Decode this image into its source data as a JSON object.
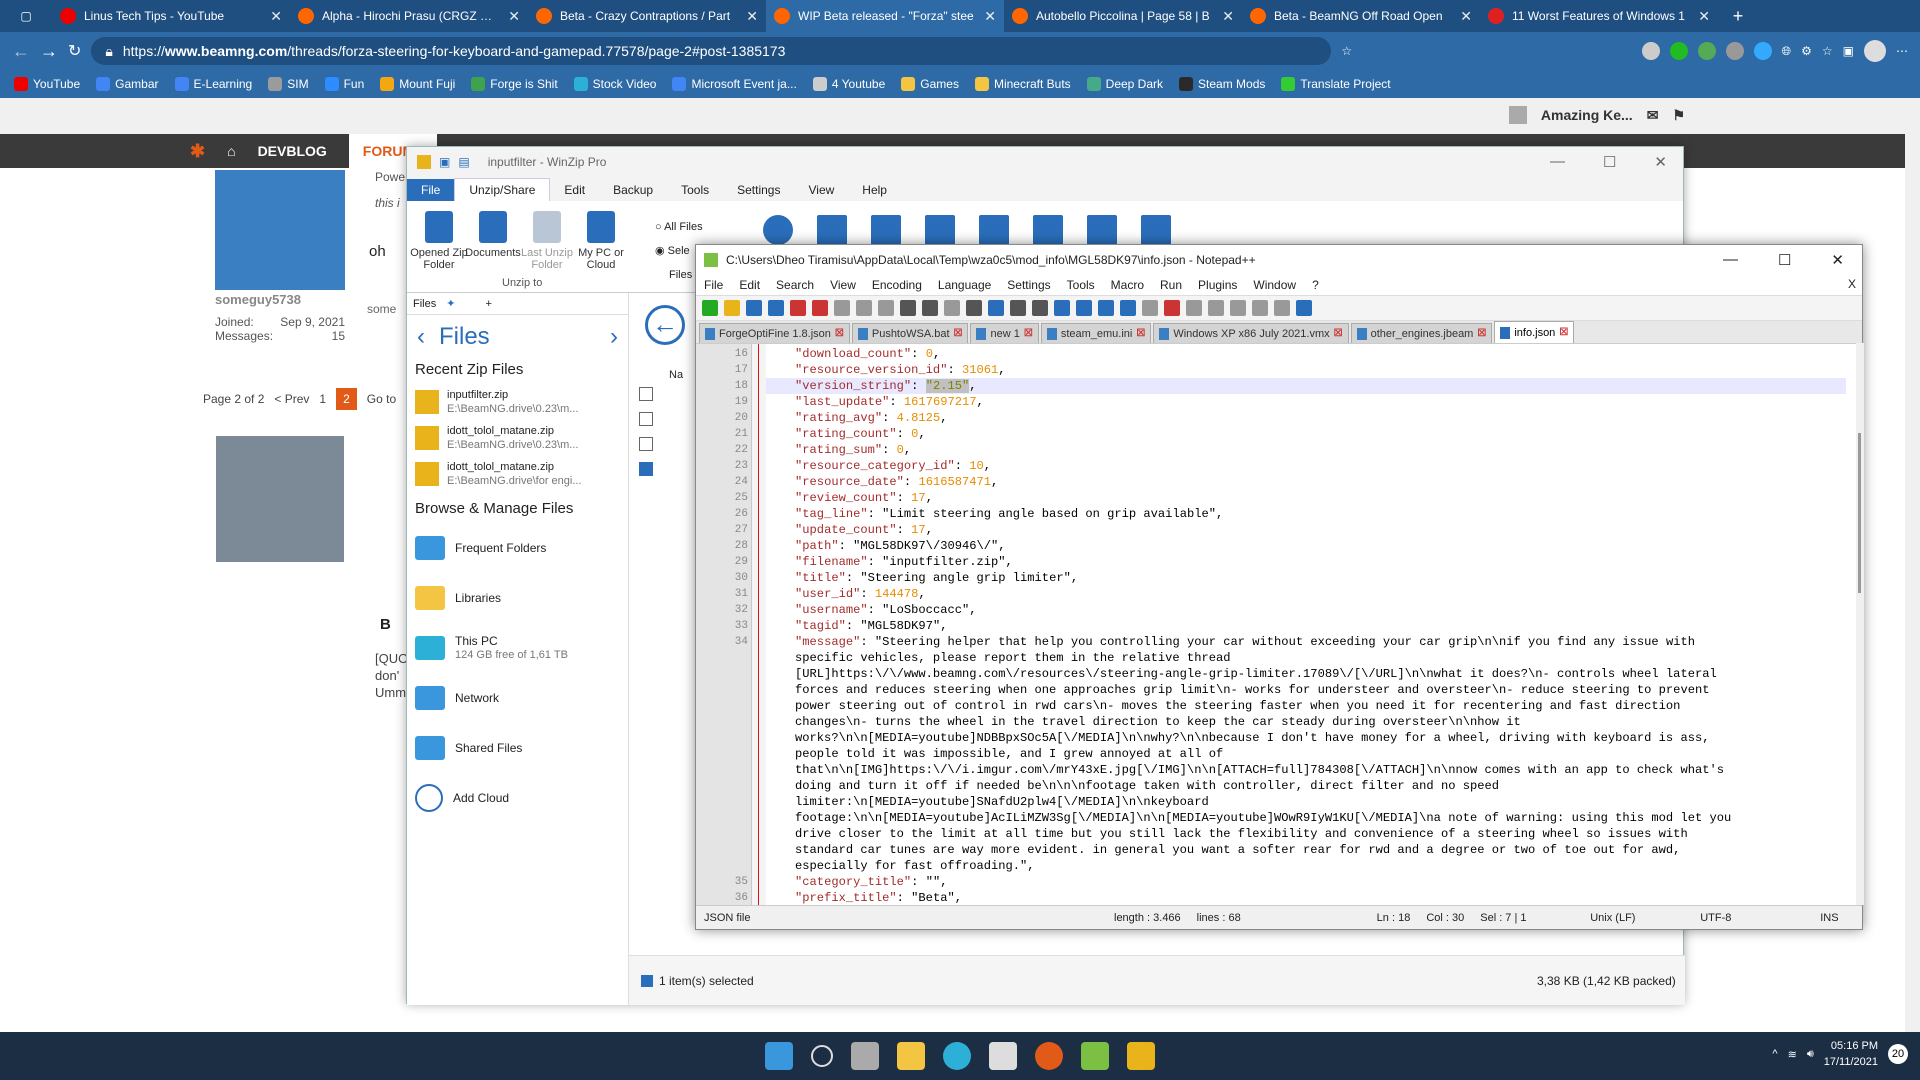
{
  "browser": {
    "tabs": [
      {
        "title": "Linus Tech Tips - YouTube",
        "color": "#e00"
      },
      {
        "title": "Alpha - Hirochi Prasu (CRGZ Rev",
        "color": "#f60"
      },
      {
        "title": "Beta - Crazy Contraptions / Part",
        "color": "#f60"
      },
      {
        "title": "WIP Beta released - \"Forza\" stee",
        "color": "#f60"
      },
      {
        "title": "Autobello Piccolina | Page 58 | B",
        "color": "#f60"
      },
      {
        "title": "Beta - BeamNG Off Road Open",
        "color": "#f60"
      },
      {
        "title": "11 Worst Features of Windows 1",
        "color": "#e02020"
      }
    ],
    "url_prefix": "https://",
    "url_host": "www.beamng.com",
    "url_path": "/threads/forza-steering-for-keyboard-and-gamepad.77578/page-2#post-1385173",
    "bookmarks": [
      "YouTube",
      "Gambar",
      "E-Learning",
      "SIM",
      "Fun",
      "Mount Fuji",
      "Forge is Shit",
      "Stock Video",
      "Microsoft Event ja...",
      "4 Youtube",
      "Games",
      "Minecraft Buts",
      "Deep Dark",
      "Steam Mods",
      "Translate Project"
    ]
  },
  "site": {
    "nav_devblog": "DEVBLOG",
    "nav_forum": "FORUMS",
    "user_badge": "Amazing Ke...",
    "post_user": "someguy5738",
    "joined_label": "Joined:",
    "joined_value": "Sep 9, 2021",
    "messages_label": "Messages:",
    "messages_value": "15",
    "post_text": "oh",
    "quote_text": "Powe",
    "quote_small": "this i",
    "page_of": "Page 2 of 2",
    "prev": "< Prev",
    "page1": "1",
    "page2": "2",
    "goto": "Go to",
    "reply_prefix": "some",
    "bold_btn": "B",
    "quick_text_1": "[QUO",
    "quick_text_2": "don'",
    "quick_text_3": "Umm"
  },
  "winzip": {
    "title": "inputfilter - WinZip Pro",
    "menu": [
      "File",
      "Unzip/Share",
      "Edit",
      "Backup",
      "Tools",
      "Settings",
      "View",
      "Help"
    ],
    "ribbon": {
      "opened_folder": "Opened Zip Folder",
      "documents": "Documents",
      "last_unzip": "Last Unzip Folder",
      "my_pc": "My PC or Cloud",
      "group": "Unzip to",
      "all_files": "All Files",
      "selected": "Sele",
      "files_to": "Files t"
    },
    "pane_tab": "Files",
    "files_header": "Files",
    "recent_title": "Recent Zip Files",
    "recent": [
      {
        "name": "inputfilter.zip",
        "path": "E:\\BeamNG.drive\\0.23\\m..."
      },
      {
        "name": "idott_tolol_matane.zip",
        "path": "E:\\BeamNG.drive\\0.23\\m..."
      },
      {
        "name": "idott_tolol_matane.zip",
        "path": "E:\\BeamNG.drive\\for engi..."
      }
    ],
    "browse_title": "Browse & Manage Files",
    "browse": [
      {
        "name": "Frequent Folders",
        "sub": ""
      },
      {
        "name": "Libraries",
        "sub": ""
      },
      {
        "name": "This PC",
        "sub": "124 GB free of 1,61 TB"
      },
      {
        "name": "Network",
        "sub": ""
      },
      {
        "name": "Shared Files",
        "sub": ""
      },
      {
        "name": "Add Cloud",
        "sub": ""
      }
    ],
    "status_selected": "1 item(s) selected",
    "status_size": "3,38 KB (1,42 KB packed)",
    "na": "Na"
  },
  "notepad": {
    "title": "C:\\Users\\Dheo Tiramisu\\AppData\\Local\\Temp\\wza0c5\\mod_info\\MGL58DK97\\info.json - Notepad++",
    "menu": [
      "File",
      "Edit",
      "Search",
      "View",
      "Encoding",
      "Language",
      "Settings",
      "Tools",
      "Macro",
      "Run",
      "Plugins",
      "Window",
      "?"
    ],
    "close_x": "X",
    "tabs": [
      {
        "name": "ForgeOptiFine 1.8.json",
        "active": false
      },
      {
        "name": "PushtoWSA.bat",
        "active": false
      },
      {
        "name": "new 1",
        "active": false
      },
      {
        "name": "steam_emu.ini",
        "active": false
      },
      {
        "name": "Windows XP x86 July 2021.vmx",
        "active": false
      },
      {
        "name": "other_engines.jbeam",
        "active": false
      },
      {
        "name": "info.json",
        "active": true
      }
    ],
    "lines": [
      {
        "n": "16",
        "k": "download_count",
        "v": "0",
        "t": "num"
      },
      {
        "n": "17",
        "k": "resource_version_id",
        "v": "31061",
        "t": "num"
      },
      {
        "n": "18",
        "k": "version_string",
        "v": "\"2.15\"",
        "t": "sel"
      },
      {
        "n": "19",
        "k": "last_update",
        "v": "1617697217",
        "t": "num"
      },
      {
        "n": "20",
        "k": "rating_avg",
        "v": "4.8125",
        "t": "num"
      },
      {
        "n": "21",
        "k": "rating_count",
        "v": "0",
        "t": "num"
      },
      {
        "n": "22",
        "k": "rating_sum",
        "v": "0",
        "t": "num"
      },
      {
        "n": "23",
        "k": "resource_category_id",
        "v": "10",
        "t": "num"
      },
      {
        "n": "24",
        "k": "resource_date",
        "v": "1616587471",
        "t": "num"
      },
      {
        "n": "25",
        "k": "review_count",
        "v": "17",
        "t": "num"
      },
      {
        "n": "26",
        "k": "tag_line",
        "v": "\"Limit steering angle based on grip available\"",
        "t": "str"
      },
      {
        "n": "27",
        "k": "update_count",
        "v": "17",
        "t": "num"
      },
      {
        "n": "28",
        "k": "path",
        "v": "\"MGL58DK97\\/30946\\/\"",
        "t": "str"
      },
      {
        "n": "29",
        "k": "filename",
        "v": "\"inputfilter.zip\"",
        "t": "str"
      },
      {
        "n": "30",
        "k": "title",
        "v": "\"Steering angle grip limiter\"",
        "t": "str"
      },
      {
        "n": "31",
        "k": "user_id",
        "v": "144478",
        "t": "num"
      },
      {
        "n": "32",
        "k": "username",
        "v": "\"LoSboccacc\"",
        "t": "str"
      },
      {
        "n": "33",
        "k": "tagid",
        "v": "\"MGL58DK97\"",
        "t": "str"
      }
    ],
    "message_line_no": "34",
    "message_key": "message",
    "message_wrapped": [
      "\"Steering helper that help you controlling your car without exceeding your car grip\\n\\nif you find any issue with",
      "specific vehicles, please report them in the relative thread",
      "[URL]https:\\/\\/www.beamng.com\\/resources\\/steering-angle-grip-limiter.17089\\/[\\/URL]\\n\\nwhat it does?\\n- controls wheel lateral",
      "forces and reduces steering when one approaches grip limit\\n- works for understeer and oversteer\\n- reduce steering to prevent",
      "power steering out of control in rwd cars\\n- moves the steering faster when you need it for recentering and fast direction",
      "changes\\n- turns the wheel in the travel direction to keep the car steady during oversteer\\n\\nhow it",
      "works?\\n\\n[MEDIA=youtube]NDBBpxSOc5A[\\/MEDIA]\\n\\nwhy?\\n\\nbecause I don't have money for a wheel, driving with keyboard is ass,",
      "people told it was impossible, and I grew annoyed at all of",
      "that\\n\\n[IMG]https:\\/\\/i.imgur.com\\/mrY43xE.jpg[\\/IMG]\\n\\n[ATTACH=full]784308[\\/ATTACH]\\n\\nnow comes with an app to check what's",
      "doing and turn it off if needed be\\n\\n\\nfootage taken with controller, direct filter and no speed",
      "limiter:\\n[MEDIA=youtube]SNafdU2plw4[\\/MEDIA]\\n\\nkeyboard",
      "footage:\\n\\n[MEDIA=youtube]AcILiMZW3Sg[\\/MEDIA]\\n\\n[MEDIA=youtube]WOwR9IyW1KU[\\/MEDIA]\\na note of warning: using this mod let you",
      "drive closer to the limit at all time but you still lack the flexibility and convenience of a steering wheel so issues with",
      "standard car tunes are way more evident. in general you want a softer rear for rwd and a degree or two of toe out for awd,",
      "especially for fast offroading.\","
    ],
    "tail_lines": [
      {
        "n": "35",
        "k": "category_title",
        "v": "\"\""
      },
      {
        "n": "36",
        "k": "prefix_title",
        "v": "\"Beta\""
      }
    ],
    "status": {
      "type": "JSON file",
      "length": "length : 3.466",
      "lines": "lines : 68",
      "ln": "Ln : 18",
      "col": "Col : 30",
      "sel": "Sel : 7 | 1",
      "eol": "Unix (LF)",
      "enc": "UTF-8",
      "ins": "INS"
    }
  },
  "taskbar": {
    "time": "05:16 PM",
    "date": "17/11/2021",
    "notif": "20"
  }
}
